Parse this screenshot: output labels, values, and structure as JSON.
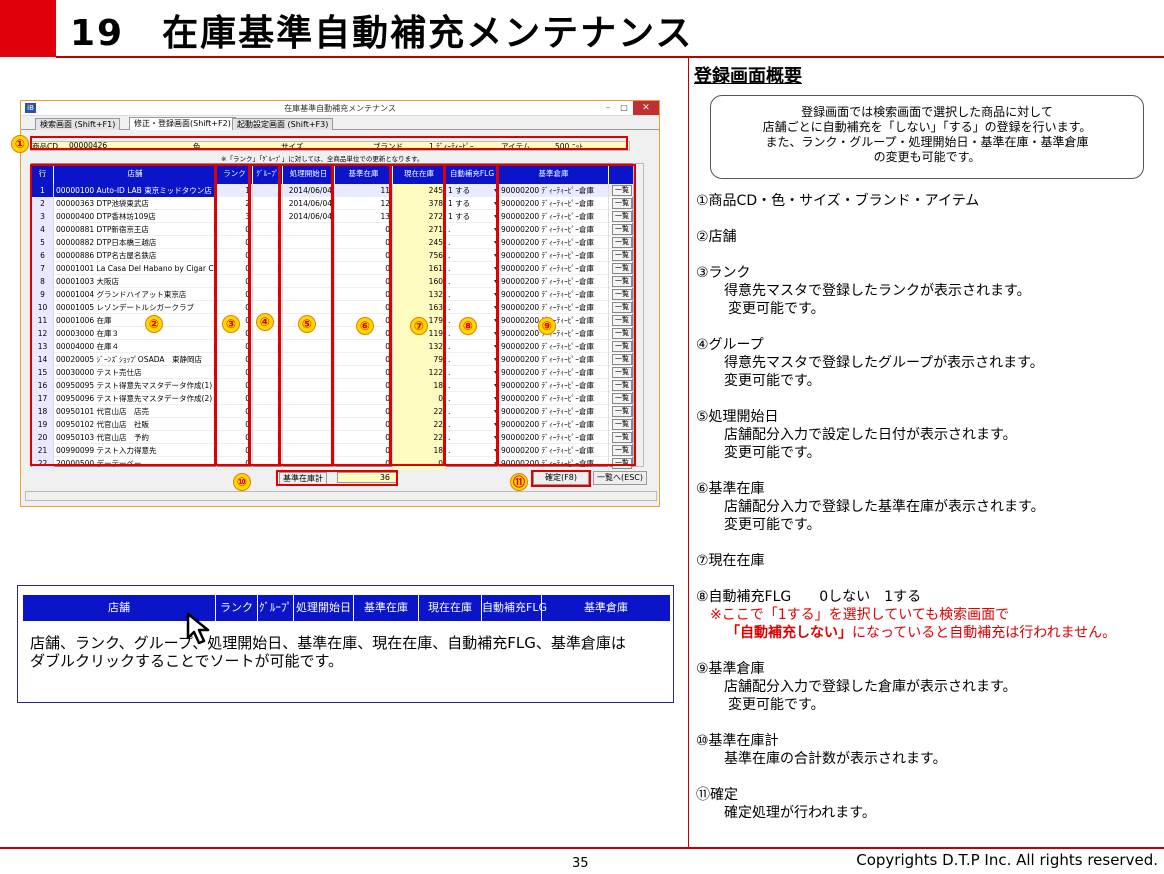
{
  "header": {
    "title": "19　在庫基準自動補充メンテナンス"
  },
  "window": {
    "title": "在庫基準自動補充メンテナンス",
    "app_icon": "iB",
    "controls": {
      "min": "–",
      "max": "□",
      "close": "✕"
    },
    "tabs": [
      "検索画面 (Shift+F1)",
      "修正・登録画面(Shift+F2)",
      "起動設定画面 (Shift+F3)"
    ],
    "criteria": {
      "product_cd_label": "商品CD",
      "product_cd": "00000426",
      "color_label": "色",
      "size_label": "サイズ",
      "brand_label": "ブランド",
      "brand": "1 ﾃﾞｨｰﾃｨｰﾋﾟｰ",
      "item_label": "アイテム",
      "item": "500 ﾆｯﾄ"
    },
    "note": "※「ランク」「ｸﾞﾙｰﾌﾟ」に対しては、全商品単位での更新となります。",
    "columns": [
      "行",
      "店舗",
      "ランク",
      "ｸﾞﾙｰﾌﾟ",
      "処理開始日",
      "基準在庫",
      "現在在庫",
      "自動補充FLG",
      "基準倉庫"
    ],
    "rows": [
      {
        "n": "1",
        "store": "00000100 Auto-ID LAB 東京ミッドタウン店",
        "rank": "1",
        "date": "2014/06/04",
        "std": "11",
        "cur": "245",
        "flg": "1 する",
        "wh": "90000200 ﾃﾞｨｰﾃｨｰﾋﾟｰ倉庫"
      },
      {
        "n": "2",
        "store": "00000363 DTP池袋東武店",
        "rank": "2",
        "date": "2014/06/04",
        "std": "12",
        "cur": "378",
        "flg": "1 する",
        "wh": "90000200 ﾃﾞｨｰﾃｨｰﾋﾟｰ倉庫"
      },
      {
        "n": "3",
        "store": "00000400 DTP香林坊109店",
        "rank": "3",
        "date": "2014/06/04",
        "std": "13",
        "cur": "272",
        "flg": "1 する",
        "wh": "90000200 ﾃﾞｨｰﾃｨｰﾋﾟｰ倉庫"
      },
      {
        "n": "4",
        "store": "00000881 DTP新宿京王店",
        "rank": "0",
        "date": "",
        "std": "0",
        "cur": "271",
        "flg": ".",
        "wh": "90000200 ﾃﾞｨｰﾃｨｰﾋﾟｰ倉庫"
      },
      {
        "n": "5",
        "store": "00000882 DTP日本橋三越店",
        "rank": "0",
        "date": "",
        "std": "0",
        "cur": "245",
        "flg": ".",
        "wh": "90000200 ﾃﾞｨｰﾃｨｰﾋﾟｰ倉庫"
      },
      {
        "n": "6",
        "store": "00000886 DTP名古屋名鉄店",
        "rank": "0",
        "date": "",
        "std": "0",
        "cur": "756",
        "flg": ".",
        "wh": "90000200 ﾃﾞｨｰﾃｨｰﾋﾟｰ倉庫"
      },
      {
        "n": "7",
        "store": "00001001 La Casa Del Habano by Cigar Club",
        "rank": "0",
        "date": "",
        "std": "0",
        "cur": "161",
        "flg": ".",
        "wh": "90000200 ﾃﾞｨｰﾃｨｰﾋﾟｰ倉庫"
      },
      {
        "n": "8",
        "store": "00001003 大阪店",
        "rank": "0",
        "date": "",
        "std": "0",
        "cur": "160",
        "flg": ".",
        "wh": "90000200 ﾃﾞｨｰﾃｨｰﾋﾟｰ倉庫"
      },
      {
        "n": "9",
        "store": "00001004 グランドハイアット東京店",
        "rank": "0",
        "date": "",
        "std": "0",
        "cur": "132",
        "flg": ".",
        "wh": "90000200 ﾃﾞｨｰﾃｨｰﾋﾟｰ倉庫"
      },
      {
        "n": "10",
        "store": "00001005 レゾンデートルシガークラブ",
        "rank": "0",
        "date": "",
        "std": "0",
        "cur": "163",
        "flg": ".",
        "wh": "90000200 ﾃﾞｨｰﾃｨｰﾋﾟｰ倉庫"
      },
      {
        "n": "11",
        "store": "00001006 在庫",
        "rank": "0",
        "date": "",
        "std": "0",
        "cur": "179",
        "flg": ".",
        "wh": "90000200 ﾃﾞｨｰﾃｨｰﾋﾟｰ倉庫"
      },
      {
        "n": "12",
        "store": "00003000 在庫３",
        "rank": "0",
        "date": "",
        "std": "0",
        "cur": "119",
        "flg": ".",
        "wh": "90000200 ﾃﾞｨｰﾃｨｰﾋﾟｰ倉庫"
      },
      {
        "n": "13",
        "store": "00004000 在庫４",
        "rank": "0",
        "date": "",
        "std": "0",
        "cur": "132",
        "flg": ".",
        "wh": "90000200 ﾃﾞｨｰﾃｨｰﾋﾟｰ倉庫"
      },
      {
        "n": "14",
        "store": "00020005 ｼﾞｰﾝｽﾞｼｮｯﾌﾟOSADA　東静岡店",
        "rank": "0",
        "date": "",
        "std": "0",
        "cur": "79",
        "flg": ".",
        "wh": "90000200 ﾃﾞｨｰﾃｨｰﾋﾟｰ倉庫"
      },
      {
        "n": "15",
        "store": "00030000 テスト売仕店",
        "rank": "0",
        "date": "",
        "std": "0",
        "cur": "122",
        "flg": ".",
        "wh": "90000200 ﾃﾞｨｰﾃｨｰﾋﾟｰ倉庫"
      },
      {
        "n": "16",
        "store": "00950095 テスト得意先マスタデータ作成(1)",
        "rank": "0",
        "date": "",
        "std": "0",
        "cur": "18",
        "flg": ".",
        "wh": "90000200 ﾃﾞｨｰﾃｨｰﾋﾟｰ倉庫"
      },
      {
        "n": "17",
        "store": "00950096 テスト得意先マスタデータ作成(2)",
        "rank": "0",
        "date": "",
        "std": "0",
        "cur": "0",
        "flg": ".",
        "wh": "90000200 ﾃﾞｨｰﾃｨｰﾋﾟｰ倉庫"
      },
      {
        "n": "18",
        "store": "00950101 代官山店　店売",
        "rank": "0",
        "date": "",
        "std": "0",
        "cur": "22",
        "flg": ".",
        "wh": "90000200 ﾃﾞｨｰﾃｨｰﾋﾟｰ倉庫"
      },
      {
        "n": "19",
        "store": "00950102 代官山店　社販",
        "rank": "0",
        "date": "",
        "std": "0",
        "cur": "22",
        "flg": ".",
        "wh": "90000200 ﾃﾞｨｰﾃｨｰﾋﾟｰ倉庫"
      },
      {
        "n": "20",
        "store": "00950103 代官山店　予約",
        "rank": "0",
        "date": "",
        "std": "0",
        "cur": "22",
        "flg": ".",
        "wh": "90000200 ﾃﾞｨｰﾃｨｰﾋﾟｰ倉庫"
      },
      {
        "n": "21",
        "store": "00990099 テスト入力得意先",
        "rank": "0",
        "date": "",
        "std": "0",
        "cur": "18",
        "flg": ".",
        "wh": "90000200 ﾃﾞｨｰﾃｨｰﾋﾟｰ倉庫"
      },
      {
        "n": "22",
        "store": "20000500 デーテーベー",
        "rank": "0",
        "date": "",
        "std": "0",
        "cur": "0",
        "flg": ".",
        "wh": "90000200 ﾃﾞｨｰﾃｨｰﾋﾟｰ倉庫"
      }
    ],
    "list_button": "一覧",
    "total_label": "基準在庫計",
    "total_value": "36",
    "confirm_button": "確定(F8)",
    "back_button": "一覧へ(ESC)",
    "markers": [
      "①",
      "②",
      "③",
      "④",
      "⑤",
      "⑥",
      "⑦",
      "⑧",
      "⑨",
      "⑩",
      "⑪"
    ]
  },
  "right": {
    "heading": "登録画面概要",
    "callout": [
      "登録画面では検索画面で選択した商品に対して",
      "店舗ごとに自動補充を「しない」「する」の登録を行います。",
      "また、ランク・グループ・処理開始日・基準在庫・基準倉庫",
      "の変更も可能です。"
    ],
    "items": [
      {
        "t": "①商品CD・色・サイズ・ブランド・アイテム",
        "d": []
      },
      {
        "t": "②店舗",
        "d": []
      },
      {
        "t": "③ランク",
        "d": [
          "得意先マスタで登録したランクが表示されます。",
          "変更可能です。"
        ]
      },
      {
        "t": "④グループ",
        "d": [
          "得意先マスタで登録したグループが表示されます。",
          "変更可能です。"
        ]
      },
      {
        "t": "⑤処理開始日",
        "d": [
          "店舗配分入力で設定した日付が表示されます。",
          "変更可能です。"
        ]
      },
      {
        "t": "⑥基準在庫",
        "d": [
          "店舗配分入力で登録した基準在庫が表示されます。",
          "変更可能です。"
        ]
      },
      {
        "t": "⑦現在在庫",
        "d": []
      },
      {
        "t": "⑧自動補充FLG　　0しない　1する",
        "red1": "※ここで「1する」を選択していても検索画面で",
        "red2a": "「自動補充しない」",
        "red2b": "になっていると自動補充は行われません。"
      },
      {
        "t": "⑨基準倉庫",
        "d": [
          "店舗配分入力で登録した倉庫が表示されます。",
          "変更可能です。"
        ]
      },
      {
        "t": "⑩基準在庫計",
        "d": [
          "基準在庫の合計数が表示されます。"
        ]
      },
      {
        "t": "⑪確定",
        "d": [
          "確定処理が行われます。"
        ]
      }
    ]
  },
  "sort_demo": {
    "columns": [
      "店舗",
      "ランク",
      "ｸﾞﾙｰﾌﾟ",
      "処理開始日",
      "基準在庫",
      "現在在庫",
      "自動補充FLG",
      "基準倉庫"
    ],
    "text1": "店舗、ランク、グループ、処理開始日、基準在庫、現在在庫、自動補充FLG、基準倉庫は",
    "text2": "ダブルクリックすることでソートが可能です。"
  },
  "footer": {
    "page": "35",
    "copyright": "Copyrights  D.T.P Inc. All rights reserved."
  }
}
